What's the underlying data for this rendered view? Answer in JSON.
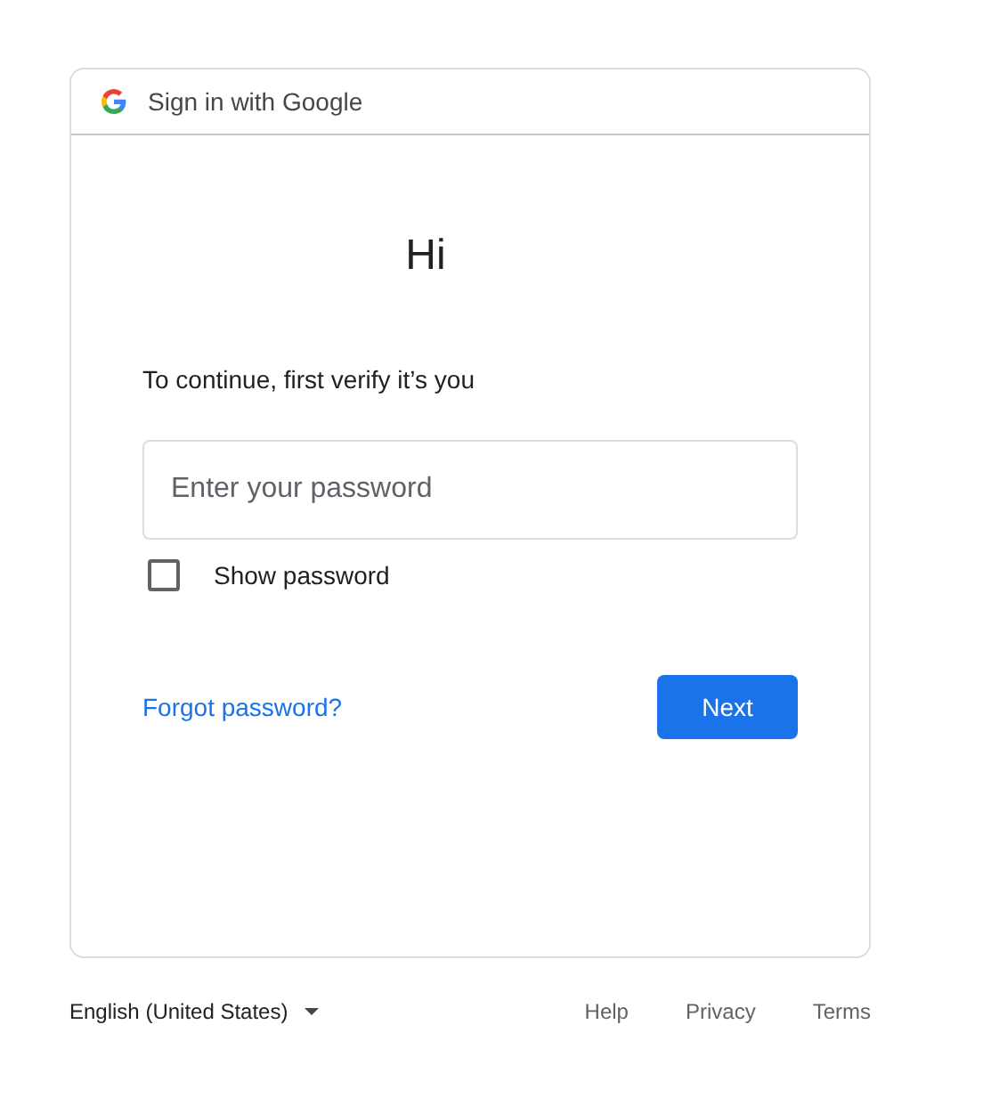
{
  "header": {
    "title": "Sign in with Google"
  },
  "greeting": "Hi",
  "prompt": "To continue, first verify it’s you",
  "password_field": {
    "placeholder": "Enter your password"
  },
  "show_password": {
    "label": "Show password",
    "checked": false
  },
  "forgot_link": "Forgot password?",
  "next_button": "Next",
  "footer": {
    "language": "English (United States)",
    "links": [
      "Help",
      "Privacy",
      "Terms"
    ]
  }
}
